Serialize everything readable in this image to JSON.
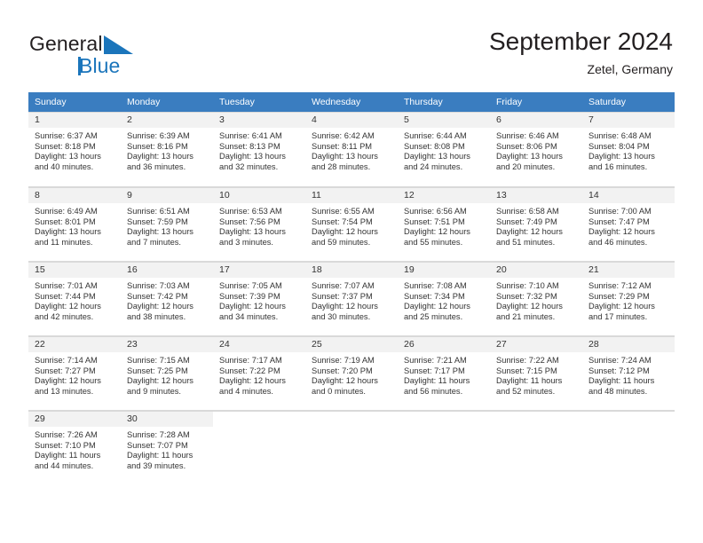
{
  "brand": {
    "name_part1": "General",
    "name_part2": "Blue",
    "triangle_color": "#1b75bb",
    "text_color": "#231f20"
  },
  "header": {
    "title": "September 2024",
    "subtitle": "Zetel, Germany"
  },
  "theme": {
    "header_row_bg": "#3a7dc0",
    "header_row_text": "#ffffff",
    "daynum_bg": "#f2f2f2",
    "grid_line": "#d9d9d9",
    "body_text": "#333333"
  },
  "weekday_headers": [
    "Sunday",
    "Monday",
    "Tuesday",
    "Wednesday",
    "Thursday",
    "Friday",
    "Saturday"
  ],
  "weeks": [
    [
      {
        "day": "1",
        "sunrise": "Sunrise: 6:37 AM",
        "sunset": "Sunset: 8:18 PM",
        "daylight1": "Daylight: 13 hours",
        "daylight2": "and 40 minutes."
      },
      {
        "day": "2",
        "sunrise": "Sunrise: 6:39 AM",
        "sunset": "Sunset: 8:16 PM",
        "daylight1": "Daylight: 13 hours",
        "daylight2": "and 36 minutes."
      },
      {
        "day": "3",
        "sunrise": "Sunrise: 6:41 AM",
        "sunset": "Sunset: 8:13 PM",
        "daylight1": "Daylight: 13 hours",
        "daylight2": "and 32 minutes."
      },
      {
        "day": "4",
        "sunrise": "Sunrise: 6:42 AM",
        "sunset": "Sunset: 8:11 PM",
        "daylight1": "Daylight: 13 hours",
        "daylight2": "and 28 minutes."
      },
      {
        "day": "5",
        "sunrise": "Sunrise: 6:44 AM",
        "sunset": "Sunset: 8:08 PM",
        "daylight1": "Daylight: 13 hours",
        "daylight2": "and 24 minutes."
      },
      {
        "day": "6",
        "sunrise": "Sunrise: 6:46 AM",
        "sunset": "Sunset: 8:06 PM",
        "daylight1": "Daylight: 13 hours",
        "daylight2": "and 20 minutes."
      },
      {
        "day": "7",
        "sunrise": "Sunrise: 6:48 AM",
        "sunset": "Sunset: 8:04 PM",
        "daylight1": "Daylight: 13 hours",
        "daylight2": "and 16 minutes."
      }
    ],
    [
      {
        "day": "8",
        "sunrise": "Sunrise: 6:49 AM",
        "sunset": "Sunset: 8:01 PM",
        "daylight1": "Daylight: 13 hours",
        "daylight2": "and 11 minutes."
      },
      {
        "day": "9",
        "sunrise": "Sunrise: 6:51 AM",
        "sunset": "Sunset: 7:59 PM",
        "daylight1": "Daylight: 13 hours",
        "daylight2": "and 7 minutes."
      },
      {
        "day": "10",
        "sunrise": "Sunrise: 6:53 AM",
        "sunset": "Sunset: 7:56 PM",
        "daylight1": "Daylight: 13 hours",
        "daylight2": "and 3 minutes."
      },
      {
        "day": "11",
        "sunrise": "Sunrise: 6:55 AM",
        "sunset": "Sunset: 7:54 PM",
        "daylight1": "Daylight: 12 hours",
        "daylight2": "and 59 minutes."
      },
      {
        "day": "12",
        "sunrise": "Sunrise: 6:56 AM",
        "sunset": "Sunset: 7:51 PM",
        "daylight1": "Daylight: 12 hours",
        "daylight2": "and 55 minutes."
      },
      {
        "day": "13",
        "sunrise": "Sunrise: 6:58 AM",
        "sunset": "Sunset: 7:49 PM",
        "daylight1": "Daylight: 12 hours",
        "daylight2": "and 51 minutes."
      },
      {
        "day": "14",
        "sunrise": "Sunrise: 7:00 AM",
        "sunset": "Sunset: 7:47 PM",
        "daylight1": "Daylight: 12 hours",
        "daylight2": "and 46 minutes."
      }
    ],
    [
      {
        "day": "15",
        "sunrise": "Sunrise: 7:01 AM",
        "sunset": "Sunset: 7:44 PM",
        "daylight1": "Daylight: 12 hours",
        "daylight2": "and 42 minutes."
      },
      {
        "day": "16",
        "sunrise": "Sunrise: 7:03 AM",
        "sunset": "Sunset: 7:42 PM",
        "daylight1": "Daylight: 12 hours",
        "daylight2": "and 38 minutes."
      },
      {
        "day": "17",
        "sunrise": "Sunrise: 7:05 AM",
        "sunset": "Sunset: 7:39 PM",
        "daylight1": "Daylight: 12 hours",
        "daylight2": "and 34 minutes."
      },
      {
        "day": "18",
        "sunrise": "Sunrise: 7:07 AM",
        "sunset": "Sunset: 7:37 PM",
        "daylight1": "Daylight: 12 hours",
        "daylight2": "and 30 minutes."
      },
      {
        "day": "19",
        "sunrise": "Sunrise: 7:08 AM",
        "sunset": "Sunset: 7:34 PM",
        "daylight1": "Daylight: 12 hours",
        "daylight2": "and 25 minutes."
      },
      {
        "day": "20",
        "sunrise": "Sunrise: 7:10 AM",
        "sunset": "Sunset: 7:32 PM",
        "daylight1": "Daylight: 12 hours",
        "daylight2": "and 21 minutes."
      },
      {
        "day": "21",
        "sunrise": "Sunrise: 7:12 AM",
        "sunset": "Sunset: 7:29 PM",
        "daylight1": "Daylight: 12 hours",
        "daylight2": "and 17 minutes."
      }
    ],
    [
      {
        "day": "22",
        "sunrise": "Sunrise: 7:14 AM",
        "sunset": "Sunset: 7:27 PM",
        "daylight1": "Daylight: 12 hours",
        "daylight2": "and 13 minutes."
      },
      {
        "day": "23",
        "sunrise": "Sunrise: 7:15 AM",
        "sunset": "Sunset: 7:25 PM",
        "daylight1": "Daylight: 12 hours",
        "daylight2": "and 9 minutes."
      },
      {
        "day": "24",
        "sunrise": "Sunrise: 7:17 AM",
        "sunset": "Sunset: 7:22 PM",
        "daylight1": "Daylight: 12 hours",
        "daylight2": "and 4 minutes."
      },
      {
        "day": "25",
        "sunrise": "Sunrise: 7:19 AM",
        "sunset": "Sunset: 7:20 PM",
        "daylight1": "Daylight: 12 hours",
        "daylight2": "and 0 minutes."
      },
      {
        "day": "26",
        "sunrise": "Sunrise: 7:21 AM",
        "sunset": "Sunset: 7:17 PM",
        "daylight1": "Daylight: 11 hours",
        "daylight2": "and 56 minutes."
      },
      {
        "day": "27",
        "sunrise": "Sunrise: 7:22 AM",
        "sunset": "Sunset: 7:15 PM",
        "daylight1": "Daylight: 11 hours",
        "daylight2": "and 52 minutes."
      },
      {
        "day": "28",
        "sunrise": "Sunrise: 7:24 AM",
        "sunset": "Sunset: 7:12 PM",
        "daylight1": "Daylight: 11 hours",
        "daylight2": "and 48 minutes."
      }
    ],
    [
      {
        "day": "29",
        "sunrise": "Sunrise: 7:26 AM",
        "sunset": "Sunset: 7:10 PM",
        "daylight1": "Daylight: 11 hours",
        "daylight2": "and 44 minutes."
      },
      {
        "day": "30",
        "sunrise": "Sunrise: 7:28 AM",
        "sunset": "Sunset: 7:07 PM",
        "daylight1": "Daylight: 11 hours",
        "daylight2": "and 39 minutes."
      },
      {
        "day": "",
        "sunrise": "",
        "sunset": "",
        "daylight1": "",
        "daylight2": ""
      },
      {
        "day": "",
        "sunrise": "",
        "sunset": "",
        "daylight1": "",
        "daylight2": ""
      },
      {
        "day": "",
        "sunrise": "",
        "sunset": "",
        "daylight1": "",
        "daylight2": ""
      },
      {
        "day": "",
        "sunrise": "",
        "sunset": "",
        "daylight1": "",
        "daylight2": ""
      },
      {
        "day": "",
        "sunrise": "",
        "sunset": "",
        "daylight1": "",
        "daylight2": ""
      }
    ]
  ]
}
